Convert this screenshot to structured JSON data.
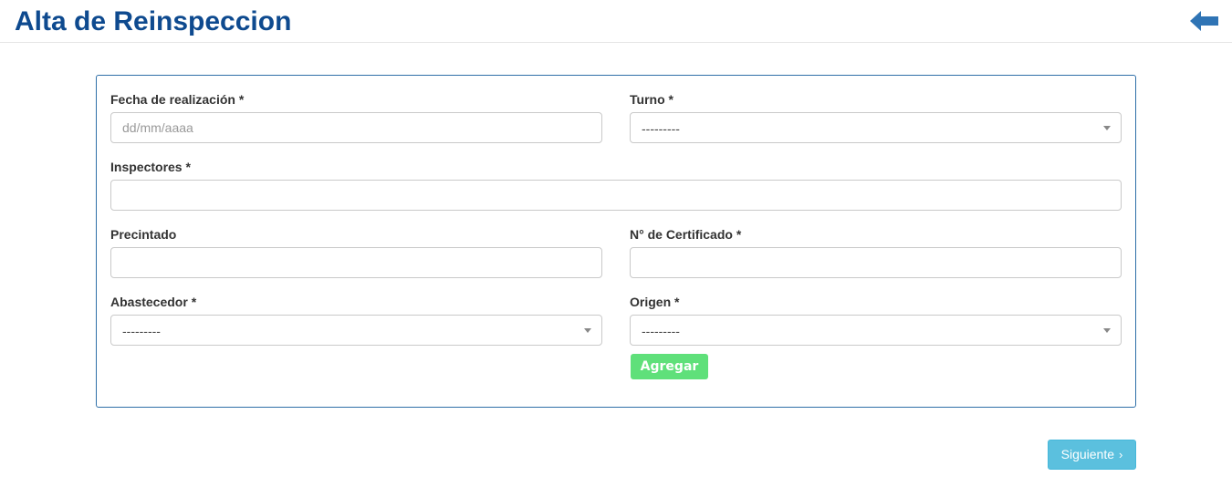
{
  "header": {
    "title": "Alta de Reinspeccion",
    "back_icon": "arrow-left-icon",
    "accent": "#0e4a8f",
    "arrow_color": "#2f74b5"
  },
  "form": {
    "fecha": {
      "label": "Fecha de realización *",
      "value": "",
      "placeholder": "dd/mm/aaaa"
    },
    "turno": {
      "label": "Turno *",
      "selected": "---------"
    },
    "inspectores": {
      "label": "Inspectores *",
      "value": ""
    },
    "precintado": {
      "label": "Precintado",
      "value": ""
    },
    "certificado": {
      "label": "N° de Certificado *",
      "value": ""
    },
    "abastecedor": {
      "label": "Abastecedor *",
      "selected": "---------"
    },
    "origen": {
      "label": "Origen *",
      "selected": "---------"
    },
    "add_label": "Agregar"
  },
  "footer": {
    "next_label": "Siguiente",
    "next_icon": "chevron-right-icon",
    "next_color": "#5bc0de",
    "add_color": "#5fe07a"
  }
}
